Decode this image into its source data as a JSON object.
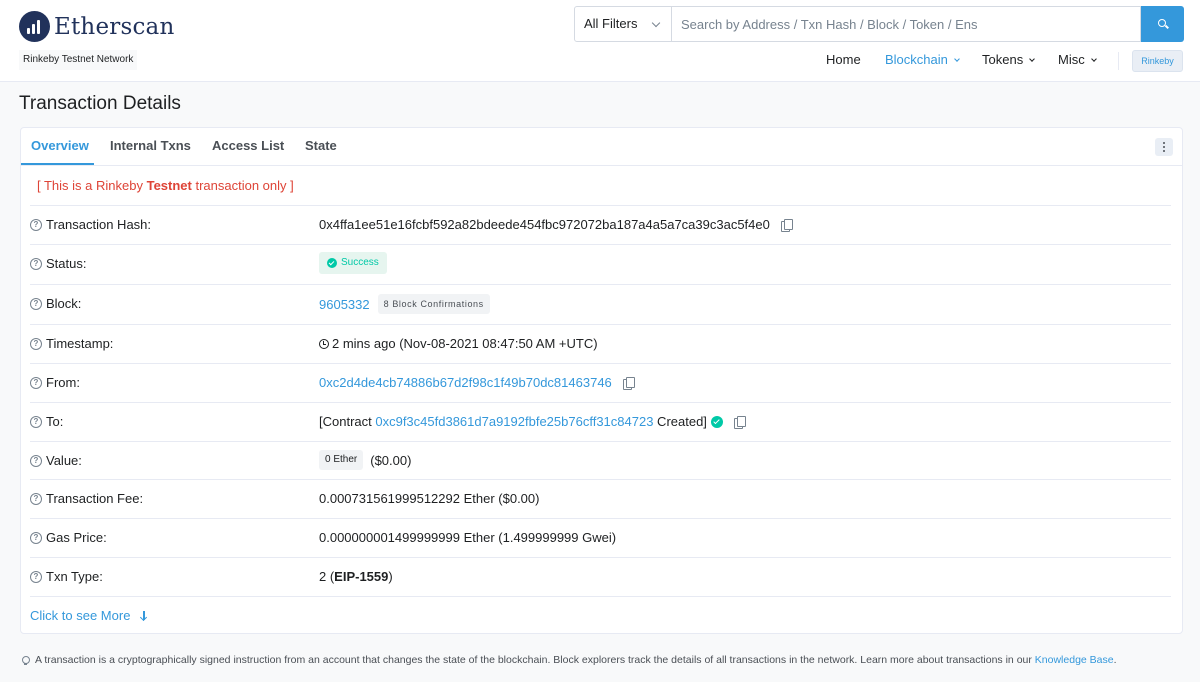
{
  "header": {
    "brand": "Etherscan",
    "network_label": "Rinkeby Testnet Network",
    "search": {
      "filter": "All Filters",
      "placeholder": "Search by Address / Txn Hash / Block / Token / Ens"
    },
    "nav": {
      "home": "Home",
      "blockchain": "Blockchain",
      "tokens": "Tokens",
      "misc": "Misc",
      "network_button": "Rinkeby"
    }
  },
  "page_title": "Transaction Details",
  "tabs": {
    "overview": "Overview",
    "internal": "Internal Txns",
    "access_list": "Access List",
    "state": "State"
  },
  "testnet_notice": {
    "prefix": "[ This is a Rinkeby ",
    "bold": "Testnet",
    "suffix": " transaction only ]"
  },
  "details": {
    "hash": {
      "label": "Transaction Hash:",
      "value": "0x4ffa1ee51e16fcbf592a82bdeede454fbc972072ba187a4a5a7ca39c3ac5f4e0"
    },
    "status": {
      "label": "Status:",
      "value": "Success"
    },
    "block": {
      "label": "Block:",
      "value": "9605332",
      "confirmations": "8 Block Confirmations"
    },
    "timestamp": {
      "label": "Timestamp:",
      "value": "2 mins ago (Nov-08-2021 08:47:50 AM +UTC)"
    },
    "from": {
      "label": "From:",
      "value": "0xc2d4de4cb74886b67d2f98c1f49b70dc81463746"
    },
    "to": {
      "label": "To:",
      "prefix": "[Contract ",
      "address": "0xc9f3c45fd3861d7a9192fbfe25b76cff31c84723",
      "suffix": " Created]"
    },
    "value": {
      "label": "Value:",
      "amount": "0 Ether",
      "usd": "($0.00)"
    },
    "fee": {
      "label": "Transaction Fee:",
      "value": "0.000731561999512292 Ether ($0.00)"
    },
    "gas_price": {
      "label": "Gas Price:",
      "value": "0.000000001499999999 Ether (1.499999999 Gwei)"
    },
    "txn_type": {
      "label": "Txn Type:",
      "prefix": "2 (",
      "bold": "EIP-1559",
      "suffix": ")"
    }
  },
  "see_more": "Click to see More",
  "footer": {
    "text": "A transaction is a cryptographically signed instruction from an account that changes the state of the blockchain. Block explorers track the details of all transactions in the network. Learn more about transactions in our ",
    "link": "Knowledge Base",
    "end": "."
  },
  "colors": {
    "link": "#3498db",
    "danger": "#de4437",
    "success": "#00c9a7",
    "brand": "#21325b"
  }
}
